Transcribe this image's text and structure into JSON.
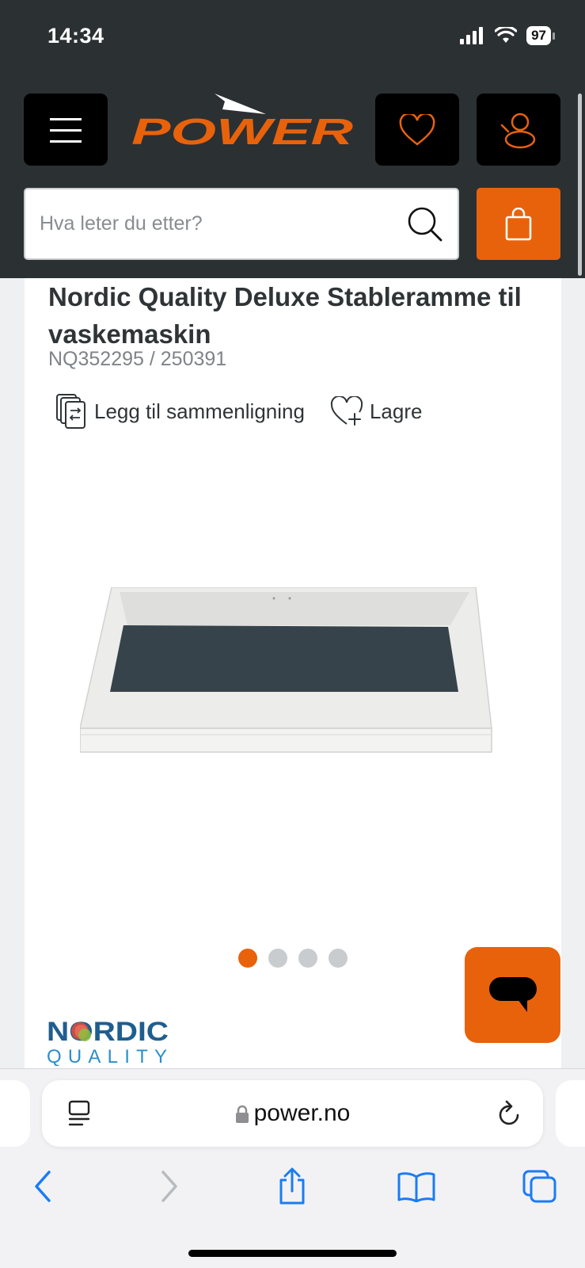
{
  "status": {
    "time": "14:34",
    "battery": "97"
  },
  "header": {
    "logo_text": "POWER",
    "search_placeholder": "Hva leter du etter?"
  },
  "product": {
    "title": "Nordic Quality Deluxe Stableramme til vaskemaskin",
    "sku": "NQ352295 / 250391",
    "compare_label": "Legg til sammenligning",
    "save_label": "Lagre",
    "image_count": 4,
    "active_image": 1,
    "brand": {
      "top": "NORDIC",
      "bottom": "QUALITY"
    }
  },
  "browser": {
    "url": "power.no"
  },
  "colors": {
    "brand_orange": "#e8620c",
    "header_dark": "#2b3033"
  },
  "icons": [
    "menu-icon",
    "heart-icon",
    "account-icon",
    "search-icon",
    "shopping-bag-icon",
    "compare-icon",
    "heart-plus-icon",
    "chat-icon",
    "lock-icon",
    "reader-icon",
    "reload-icon",
    "back-icon",
    "forward-icon",
    "share-icon",
    "bookmarks-icon",
    "tabs-icon"
  ]
}
